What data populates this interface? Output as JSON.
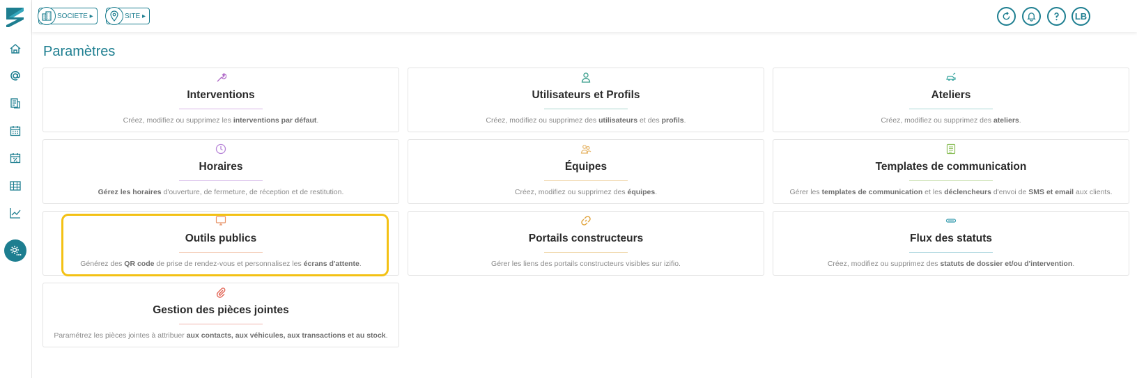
{
  "header": {
    "societe_label": "SOCIETE ▸",
    "site_label": "SITE ▸",
    "user_initials": "LB"
  },
  "page": {
    "title": "Paramètres"
  },
  "colors": {
    "brand": "#1d7e90",
    "highlight": "#f3c114"
  },
  "sidebar": {
    "items": [
      {
        "name": "home-icon"
      },
      {
        "name": "at-icon"
      },
      {
        "name": "documents-icon"
      },
      {
        "name": "calendar-icon"
      },
      {
        "name": "calendar-percent-icon"
      },
      {
        "name": "table-icon"
      },
      {
        "name": "chart-icon"
      },
      {
        "name": "settings-icon"
      }
    ]
  },
  "cards": [
    {
      "title": "Interventions",
      "color": "#b06ac8",
      "desc_parts": [
        "Créez, modifiez ou supprimez les ",
        "interventions par défaut",
        "."
      ]
    },
    {
      "title": "Utilisateurs et Profils",
      "color": "#3a9e8c",
      "desc_parts": [
        "Créez, modifiez ou supprimez des ",
        "utilisateurs",
        " et des ",
        "profils",
        "."
      ]
    },
    {
      "title": "Ateliers",
      "color": "#3aa6a0",
      "desc_parts": [
        "Créez, modifiez ou supprimez des ",
        "ateliers",
        "."
      ]
    },
    {
      "title": "Horaires",
      "color": "#b886d8",
      "desc_parts": [
        "Gérez les horaires",
        " d'ouverture, de fermeture, de réception et de restitution."
      ]
    },
    {
      "title": "Équipes",
      "color": "#e6b66a",
      "desc_parts": [
        "Créez, modifiez ou supprimez des ",
        "équipes",
        "."
      ]
    },
    {
      "title": "Templates de communication",
      "color": "#8cbf5a",
      "desc_parts": [
        "Gérer les ",
        "templates de communication",
        " et les ",
        "déclencheurs",
        " d'envoi de ",
        "SMS et email",
        " aux clients."
      ]
    },
    {
      "title": "Outils publics",
      "color": "#e8956a",
      "desc_parts": [
        "Générez des ",
        "QR code",
        " de prise de rendez-vous et personnalisez les ",
        "écrans d'attente",
        "."
      ]
    },
    {
      "title": "Portails constructeurs",
      "color": "#e0a23a",
      "desc_parts": [
        "Gérer les liens des portails constructeurs visibles sur izifio."
      ]
    },
    {
      "title": "Flux des statuts",
      "color": "#3a9eb0",
      "desc_parts": [
        "Créez, modifiez ou supprimez des ",
        "statuts de dossier et/ou d'intervention",
        "."
      ]
    },
    {
      "title": "Gestion des pièces jointes",
      "color": "#e05a4a",
      "desc_parts": [
        "Paramétrez les pièces jointes à attribuer ",
        "aux contacts, aux véhicules, aux transactions et au stock",
        "."
      ]
    }
  ]
}
